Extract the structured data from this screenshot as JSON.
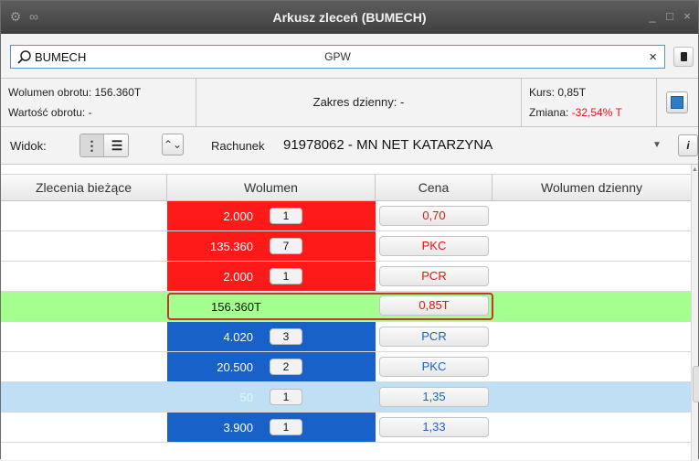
{
  "window": {
    "title": "Arkusz zleceń (BUMECH)",
    "minimize": "_",
    "maximize": "□",
    "close": "×"
  },
  "search": {
    "value": "BUMECH",
    "market": "GPW",
    "clear": "×"
  },
  "info": {
    "volume": "Wolumen obrotu: 156.360T",
    "value": "Wartość obrotu: -",
    "day_range": "Zakres dzienny: -",
    "rate": "Kurs: 0,85T",
    "change_label": "Zmiana: ",
    "change_value": "-32,54% T"
  },
  "toolbar": {
    "view_label": "Widok:",
    "account_label": "Rachunek",
    "account_value": "91978062 - MN NET KATARZYNA",
    "info_button": "i"
  },
  "grid": {
    "headers": [
      "Zlecenia bieżące",
      "Wolumen",
      "Cena",
      "Wolumen dzienny"
    ],
    "sell_rows": [
      {
        "volume": "2.000",
        "count": "1",
        "price": "0,70"
      },
      {
        "volume": "135.360",
        "count": "7",
        "price": "PKC"
      },
      {
        "volume": "2.000",
        "count": "1",
        "price": "PCR"
      }
    ],
    "trade": {
      "volume": "156.360T",
      "price": "0,85T"
    },
    "buy_rows": [
      {
        "volume": "4.020",
        "count": "3",
        "price": "PCR"
      },
      {
        "volume": "20.500",
        "count": "2",
        "price": "PKC"
      },
      {
        "volume": "50",
        "count": "1",
        "price": "1,35"
      },
      {
        "volume": "3.900",
        "count": "1",
        "price": "1,33"
      }
    ]
  },
  "colors": {
    "sell": "#ff1a1a",
    "buy": "#1761c8",
    "last_trade": "#a4ff8f",
    "light_buy": "#bfe0f4"
  }
}
